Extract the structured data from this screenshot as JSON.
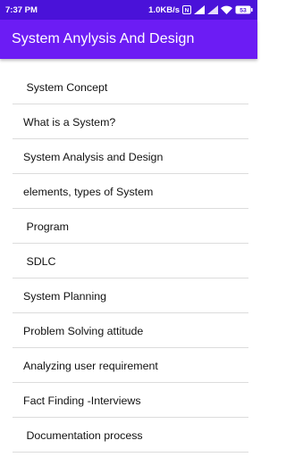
{
  "status_bar": {
    "time": "7:37 PM",
    "speed": "1.0KB/s",
    "battery": "53"
  },
  "app_bar": {
    "title": "System Anylysis And Design"
  },
  "topics": [
    {
      "label": " System Concept"
    },
    {
      "label": "What is a System?"
    },
    {
      "label": "System Analysis and Design"
    },
    {
      "label": "elements, types of System"
    },
    {
      "label": " Program"
    },
    {
      "label": " SDLC"
    },
    {
      "label": "System Planning"
    },
    {
      "label": "Problem Solving attitude"
    },
    {
      "label": "Analyzing user requirement"
    },
    {
      "label": "Fact Finding -Interviews"
    },
    {
      "label": " Documentation process"
    }
  ],
  "colors": {
    "status_bar": "#4a12d9",
    "app_bar": "#6c1cf4"
  }
}
